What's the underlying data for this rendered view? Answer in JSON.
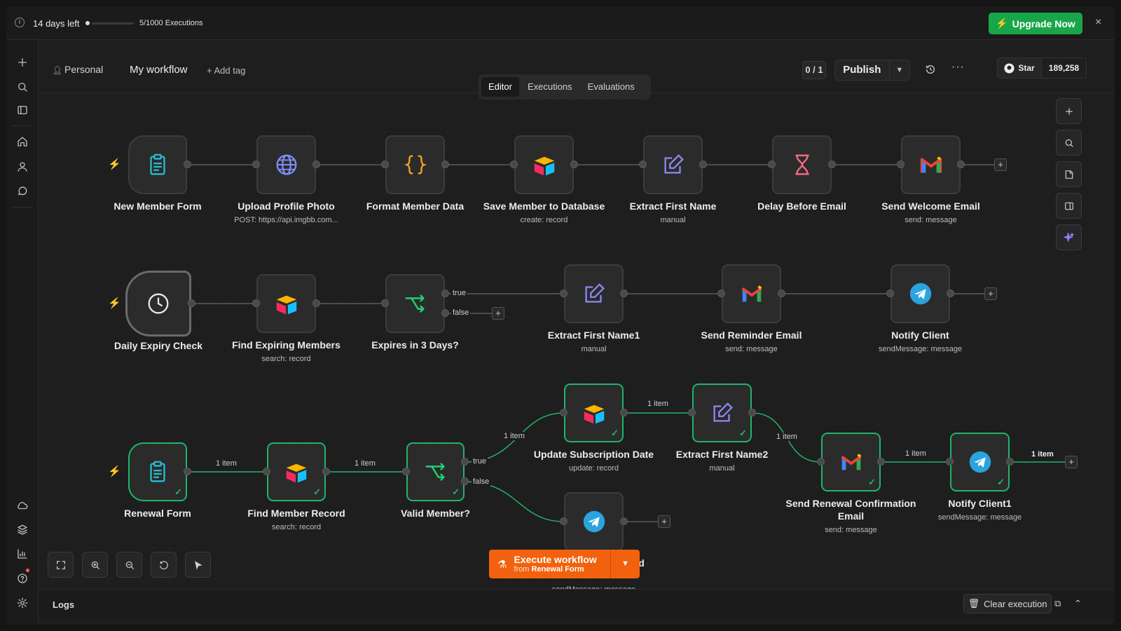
{
  "banner": {
    "days_left": "14 days left",
    "executions": "5/1000 Executions",
    "trial_progress_fraction": 0.01,
    "upgrade_label": "Upgrade Now",
    "close": "×"
  },
  "header": {
    "project": "Personal",
    "workflow_name": "My workflow",
    "add_tag": "+ Add tag",
    "counter": "0 / 1",
    "publish": "Publish",
    "more": "···",
    "github_star": "Star",
    "github_count": "189,258"
  },
  "tabs": [
    {
      "label": "Editor",
      "active": true
    },
    {
      "label": "Executions",
      "active": false
    },
    {
      "label": "Evaluations",
      "active": false
    }
  ],
  "nodes": {
    "n1": {
      "name": "New Member Form",
      "sub": ""
    },
    "n2": {
      "name": "Upload Profile Photo",
      "sub": "POST: https://api.imgbb.com..."
    },
    "n3": {
      "name": "Format Member Data",
      "sub": ""
    },
    "n4": {
      "name": "Save Member to Database",
      "sub": "create: record"
    },
    "n5": {
      "name": "Extract First Name",
      "sub": "manual"
    },
    "n6": {
      "name": "Delay Before Email",
      "sub": ""
    },
    "n7": {
      "name": "Send Welcome Email",
      "sub": "send: message"
    },
    "m1": {
      "name": "Daily Expiry Check",
      "sub": ""
    },
    "m2": {
      "name": "Find Expiring Members",
      "sub": "search: record"
    },
    "m3": {
      "name": "Expires in 3 Days?",
      "sub": ""
    },
    "m4": {
      "name": "Extract First Name1",
      "sub": "manual"
    },
    "m5": {
      "name": "Send Reminder Email",
      "sub": "send: message"
    },
    "m6": {
      "name": "Notify Client",
      "sub": "sendMessage: message"
    },
    "r1": {
      "name": "Renewal Form",
      "sub": ""
    },
    "r2": {
      "name": "Find Member Record",
      "sub": "search: record"
    },
    "r3": {
      "name": "Valid Member?",
      "sub": ""
    },
    "r4": {
      "name": "Update Subscription Date",
      "sub": "update: record"
    },
    "r5": {
      "name": "Extract First Name2",
      "sub": "manual"
    },
    "r6": {
      "name": "Send Renewal Confirmation Email",
      "sub": "send: message"
    },
    "r7": {
      "name": "Notify Client1",
      "sub": "sendMessage: message"
    },
    "r8": {
      "name": "d",
      "sub": "sendMessage: message"
    }
  },
  "edge_labels": {
    "true": "true",
    "false": "false",
    "one_item": "1 item"
  },
  "execute": {
    "label": "Execute workflow",
    "from_prefix": "from",
    "from_node": "Renewal Form"
  },
  "logs": {
    "title": "Logs",
    "clear": "Clear execution"
  },
  "colors": {
    "accent_orange": "#f2610e",
    "success_green": "#20b46a",
    "upgrade_green": "#19a64a",
    "trigger_bolt": "#ff6d2d"
  }
}
